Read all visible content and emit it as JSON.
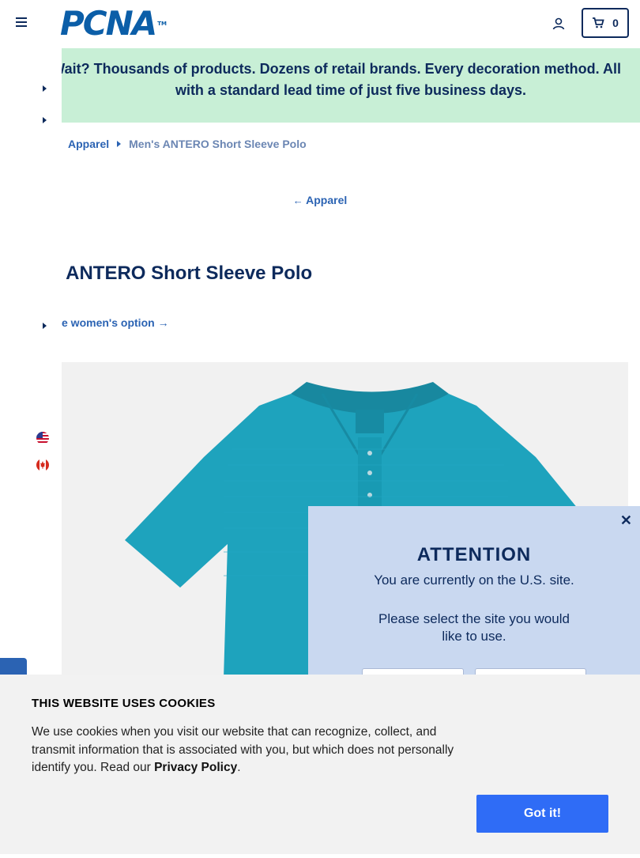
{
  "header": {
    "logo_text": "PCNA",
    "logo_tm": "TM",
    "cart_count": "0"
  },
  "promo": {
    "line1": "Wait? Thousands of products. Dozens of retail brands. Every decoration method. All",
    "line2": "with a standard lead time of just five business days."
  },
  "breadcrumb": {
    "parent": "Apparel",
    "current": "Men's ANTERO Short Sleeve Polo"
  },
  "back_link": {
    "label": "Apparel"
  },
  "product": {
    "title": "Men's ANTERO Short Sleeve Polo",
    "title_visible": "s ANTERO Short Sleeve Polo",
    "women_option": "e women's option",
    "shirt_color": "#1ea3bd"
  },
  "site_modal": {
    "heading": "ATTENTION",
    "message1": "You are currently on the U.S. site.",
    "message2": "Please select the site you would like to use."
  },
  "cookie_banner": {
    "title": "THIS WEBSITE USES COOKIES",
    "text": "We use cookies when you visit our website that can recognize, collect, and transmit information that is associated with you, but which does not personally identify you. Read our ",
    "link": "Privacy Policy",
    "text_end": ".",
    "button": "Got it!"
  },
  "colors": {
    "navy": "#0d2a5c",
    "link_blue": "#2b63b3",
    "promo_green": "#c8efd6",
    "modal_blue": "#c9d8f0",
    "button_blue": "#2f6cf6"
  },
  "icons": [
    "hamburger-icon",
    "account-icon",
    "cart-icon",
    "arrow-left-icon",
    "arrow-right-icon",
    "us-flag-icon",
    "canada-flag-icon",
    "close-icon"
  ]
}
